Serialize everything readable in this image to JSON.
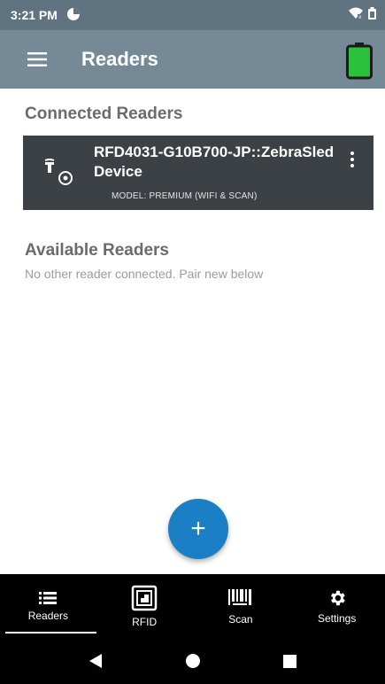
{
  "status_bar": {
    "time": "3:21 PM"
  },
  "app_bar": {
    "title": "Readers"
  },
  "connected": {
    "title": "Connected Readers",
    "reader": {
      "name": "RFD4031-G10B700-JP::ZebraSledDevice",
      "model": "MODEL: PREMIUM (WIFI & SCAN)"
    }
  },
  "available": {
    "title": "Available Readers",
    "hint": "No other reader connected. Pair new below"
  },
  "fab": {
    "label": "+"
  },
  "bottom_nav": {
    "items": [
      {
        "label": "Readers",
        "icon": "list-icon"
      },
      {
        "label": "RFID",
        "icon": "rfid-tag-icon"
      },
      {
        "label": "Scan",
        "icon": "barcode-icon"
      },
      {
        "label": "Settings",
        "icon": "gear-icon"
      }
    ],
    "active": "Readers"
  },
  "colors": {
    "status_bar": "#5f7480",
    "app_bar": "#758a96",
    "card": "#3c4146",
    "fab": "#1a7fc4",
    "battery": "#2bc13a"
  }
}
